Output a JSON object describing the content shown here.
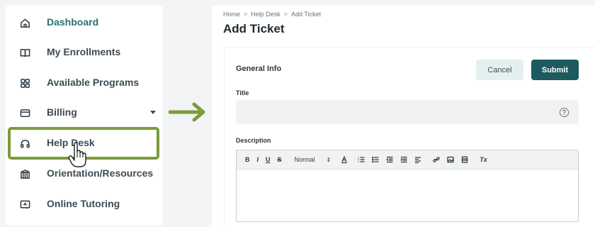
{
  "sidebar": {
    "items": [
      {
        "label": "Dashboard",
        "icon": "home-icon"
      },
      {
        "label": "My Enrollments",
        "icon": "book-icon"
      },
      {
        "label": "Available Programs",
        "icon": "grid-icon"
      },
      {
        "label": "Billing",
        "icon": "credit-card-icon"
      },
      {
        "label": "Help Desk",
        "icon": "headset-icon"
      },
      {
        "label": "Orientation/Resources",
        "icon": "bank-icon"
      },
      {
        "label": "Online Tutoring",
        "icon": "screen-icon"
      }
    ]
  },
  "breadcrumb": {
    "home": "Home",
    "section": "Help Desk",
    "current": "Add Ticket",
    "separator": ">"
  },
  "page": {
    "title": "Add Ticket"
  },
  "form": {
    "section_heading": "General Info",
    "cancel_label": "Cancel",
    "submit_label": "Submit",
    "title_label": "Title",
    "title_value": "",
    "description_label": "Description",
    "description_value": "",
    "toolbar": {
      "bold": "B",
      "italic": "I",
      "underline": "U",
      "strike": "S",
      "style_select": "Normal",
      "clear_format": "Tx"
    }
  },
  "colors": {
    "highlight": "#7a9c3a",
    "accent": "#1d5a5f",
    "active_text": "#2b6f73"
  }
}
